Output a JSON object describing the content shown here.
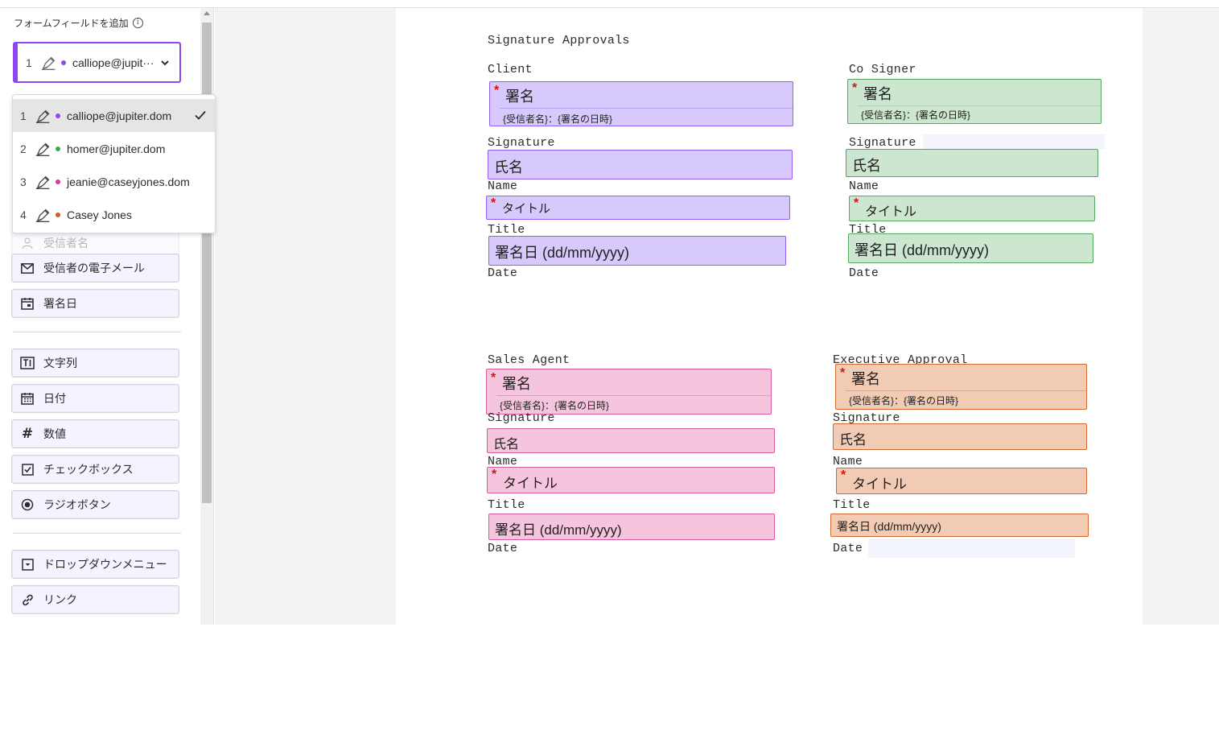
{
  "panel": {
    "title": "フォームフィールドを追加",
    "selected_recipient": {
      "number": "1",
      "label": "calliope@jupit···"
    },
    "recipients": [
      {
        "number": "1",
        "email": "calliope@jupiter.dom",
        "color": "#8e47f0",
        "selected": true
      },
      {
        "number": "2",
        "email": "homer@jupiter.dom",
        "color": "#3da74a"
      },
      {
        "number": "3",
        "email": "jeanie@caseyjones.dom",
        "color": "#d33a9a"
      },
      {
        "number": "4",
        "email": "Casey Jones",
        "color": "#cf5a23"
      }
    ],
    "hidden_field_label": "受信者名",
    "fields": [
      {
        "label": "受信者の電子メール",
        "icon": "envelope-icon"
      },
      {
        "label": "署名日",
        "icon": "calendar-signature-icon"
      },
      {
        "label": "文字列",
        "icon": "text-field-icon"
      },
      {
        "label": "日付",
        "icon": "calendar-icon"
      },
      {
        "label": "数値",
        "icon": "hash-icon"
      },
      {
        "label": "チェックボックス",
        "icon": "checkbox-icon"
      },
      {
        "label": "ラジオボタン",
        "icon": "radio-button-icon"
      },
      {
        "label": "ドロップダウンメニュー",
        "icon": "dropdown-icon"
      },
      {
        "label": "リンク",
        "icon": "link-icon"
      }
    ]
  },
  "document": {
    "heading": "Signature Approvals",
    "labels": {
      "signature": "Signature",
      "name": "Name",
      "title": "Title",
      "date": "Date"
    },
    "field_text": {
      "signature": "署名",
      "signature_sub": "{受信者名}：{署名の日時}",
      "name": "氏名",
      "title": "タイトル",
      "date": "署名日 (dd/mm/yyyy)",
      "required_mark": "*"
    },
    "blocks": [
      {
        "heading": "Client",
        "color": "#8e5ff0"
      },
      {
        "heading": "Co Signer",
        "color": "#55a860"
      },
      {
        "heading": "Sales Agent",
        "color": "#d65b9f"
      },
      {
        "heading": "Executive Approval",
        "color": "#cf6b30"
      }
    ]
  }
}
